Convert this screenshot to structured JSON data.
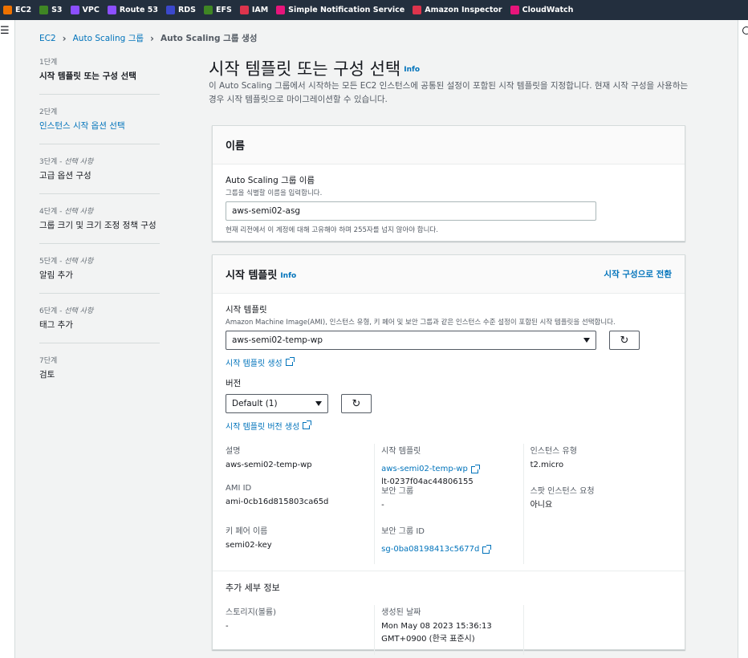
{
  "topbar": {
    "services": [
      {
        "label": "EC2",
        "color": "#ed7100",
        "icon": "ec2-icon"
      },
      {
        "label": "S3",
        "color": "#3f8624",
        "icon": "s3-icon"
      },
      {
        "label": "VPC",
        "color": "#8c4fff",
        "icon": "vpc-icon"
      },
      {
        "label": "Route 53",
        "color": "#8c4fff",
        "icon": "route53-icon"
      },
      {
        "label": "RDS",
        "color": "#3b48cc",
        "icon": "rds-icon"
      },
      {
        "label": "EFS",
        "color": "#3f8624",
        "icon": "efs-icon"
      },
      {
        "label": "IAM",
        "color": "#dd344c",
        "icon": "iam-icon"
      },
      {
        "label": "Simple Notification Service",
        "color": "#e7157b",
        "icon": "sns-icon"
      },
      {
        "label": "Amazon Inspector",
        "color": "#dd344c",
        "icon": "inspector-icon"
      },
      {
        "label": "CloudWatch",
        "color": "#e7157b",
        "icon": "cloudwatch-icon"
      }
    ]
  },
  "breadcrumb": {
    "items": [
      "EC2",
      "Auto Scaling 그룹"
    ],
    "current": "Auto Scaling 그룹 생성"
  },
  "steps": [
    {
      "num": "1단계",
      "optional": "",
      "title": "시작 템플릿 또는 구성 선택",
      "state": "active"
    },
    {
      "num": "2단계",
      "optional": "",
      "title": "인스턴스 시작 옵션 선택",
      "state": "link"
    },
    {
      "num": "3단계 - ",
      "optional": "선택 사항",
      "title": "고급 옵션 구성",
      "state": "normal"
    },
    {
      "num": "4단계 - ",
      "optional": "선택 사항",
      "title": "그룹 크기 및 크기 조정 정책 구성",
      "state": "normal"
    },
    {
      "num": "5단계 - ",
      "optional": "선택 사항",
      "title": "알림 추가",
      "state": "normal"
    },
    {
      "num": "6단계 - ",
      "optional": "선택 사항",
      "title": "태그 추가",
      "state": "normal"
    },
    {
      "num": "7단계",
      "optional": "",
      "title": "검토",
      "state": "normal"
    }
  ],
  "main": {
    "title": "시작 템플릿 또는 구성 선택",
    "info": "Info",
    "description": "이 Auto Scaling 그룹에서 시작하는 모든 EC2 인스턴스에 공통된 설정이 포함된 시작 템플릿을 지정합니다. 현재 시작 구성을 사용하는 경우 시작 템플릿으로 마이그레이션할 수 있습니다."
  },
  "name_panel": {
    "title": "이름",
    "label": "Auto Scaling 그룹 이름",
    "hint": "그룹을 식별할 이름을 입력합니다.",
    "value": "aws-semi02-asg",
    "help": "현재 리전에서 이 계정에 대해 고유해야 하며 255자를 넘지 않아야 합니다."
  },
  "template_panel": {
    "title": "시작 템플릿",
    "info": "Info",
    "switch_link": "시작 구성으로 전환",
    "template_label": "시작 템플릿",
    "template_hint": "Amazon Machine Image(AMI), 인스턴스 유형, 키 페어 및 보안 그룹과 같은 인스턴스 수준 설정이 포함된 시작 템플릿을 선택합니다.",
    "template_value": "aws-semi02-temp-wp",
    "create_template_link": "시작 템플릿 생성",
    "version_label": "버전",
    "version_value": "Default (1)",
    "create_version_link": "시작 템플릿 버전 생성",
    "details": {
      "col1": [
        {
          "label": "설명",
          "value": "aws-semi02-temp-wp"
        },
        {
          "label": "AMI ID",
          "value": "ami-0cb16d815803ca65d"
        },
        {
          "label": "키 페어 이름",
          "value": "semi02-key"
        }
      ],
      "col2": [
        {
          "label": "시작 템플릿",
          "value": "aws-semi02-temp-wp",
          "sub": "lt-0237f04ac44806155"
        },
        {
          "label": "보안 그룹",
          "value": "-"
        },
        {
          "label": "보안 그룹 ID",
          "value": "sg-0ba08198413c5677d"
        }
      ],
      "col3": [
        {
          "label": "인스턴스 유형",
          "value": "t2.micro"
        },
        {
          "label": "스팟 인스턴스 요청",
          "value": "아니요"
        }
      ]
    },
    "extra": {
      "title": "추가 세부 정보",
      "storage_label": "스토리지(볼륨)",
      "storage_value": "-",
      "created_label": "생성된 날짜",
      "created_value_1": "Mon May 08 2023 15:36:13",
      "created_value_2": "GMT+0900 (한국 표준시)"
    }
  }
}
